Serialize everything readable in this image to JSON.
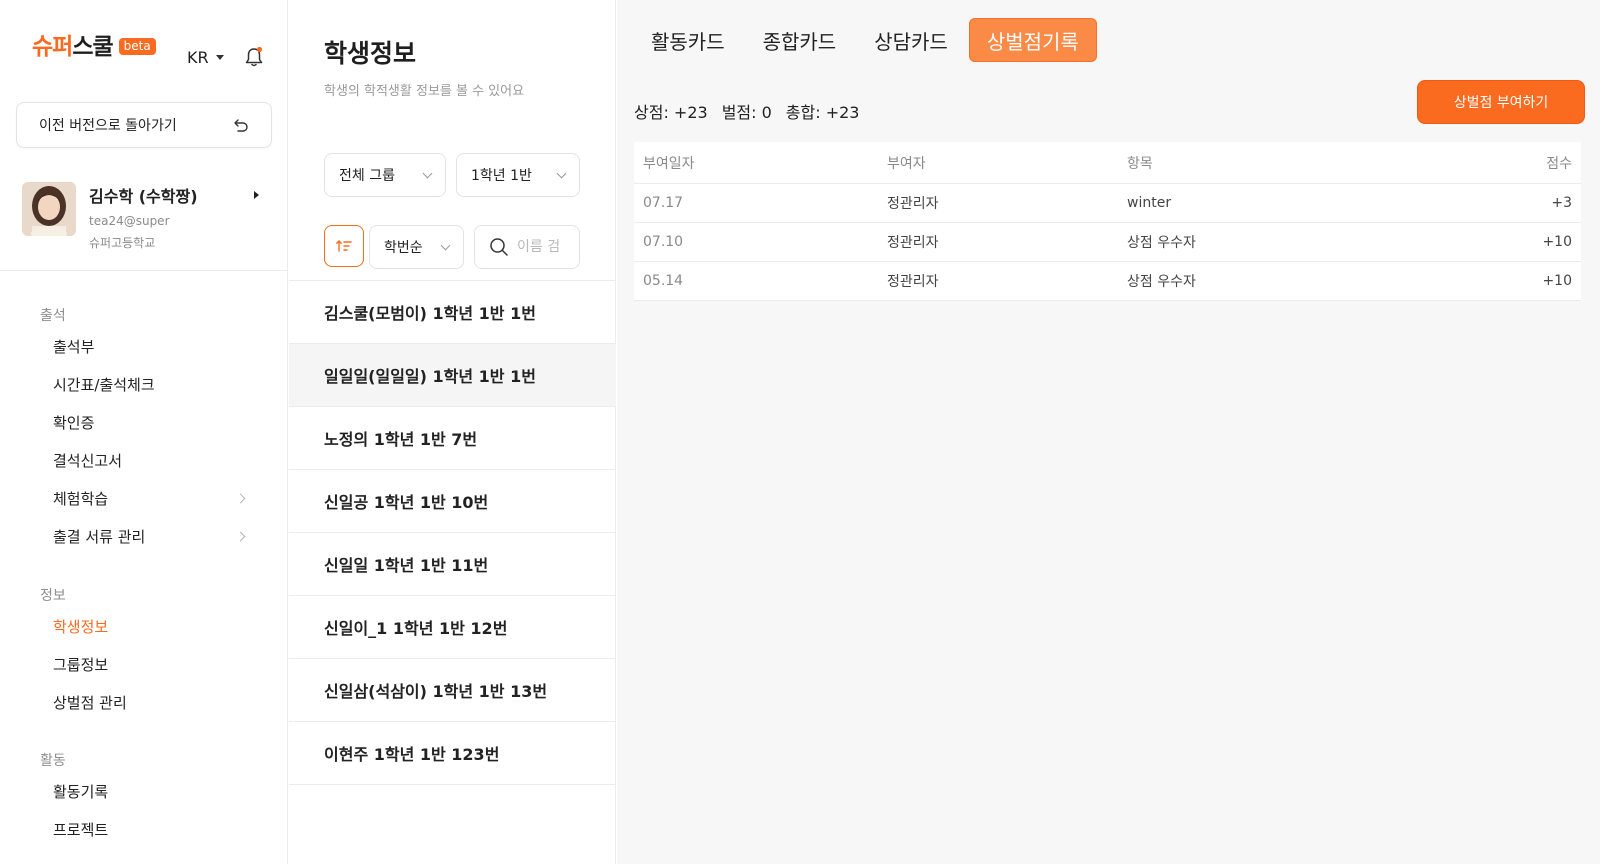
{
  "sidebar": {
    "logo_part1": "슈퍼",
    "logo_part2": "스쿨",
    "beta": "beta",
    "lang": "KR",
    "back_button": "이전 버전으로 돌아가기",
    "profile": {
      "name": "김수학 (수학짱)",
      "email": "tea24@super",
      "school": "슈퍼고등학교"
    },
    "sections": [
      {
        "title": "출석",
        "items": [
          "출석부",
          "시간표/출석체크",
          "확인증",
          "결석신고서",
          "체험학습",
          "출결 서류 관리"
        ]
      },
      {
        "title": "정보",
        "items": [
          "학생정보",
          "그룹정보",
          "상벌점 관리"
        ]
      },
      {
        "title": "활동",
        "items": [
          "활동기록",
          "프로젝트"
        ]
      }
    ]
  },
  "middle": {
    "title": "학생정보",
    "description": "학생의 학적생활 정보를 볼 수 있어요",
    "group_select": "전체 그룹",
    "class_select": "1학년 1반",
    "sort_select": "학번순",
    "search_placeholder": "이름 검",
    "students": [
      "김스쿨(모범이) 1학년 1반 1번",
      "일일일(일일일) 1학년 1반 1번",
      "노정의 1학년 1반 7번",
      "신일공 1학년 1반 10번",
      "신일일 1학년 1반 11번",
      "신일이_1 1학년 1반 12번",
      "신일삼(석삼이) 1학년 1반 13번",
      "이현주 1학년 1반 123번"
    ]
  },
  "right": {
    "tabs": [
      "활동카드",
      "종합카드",
      "상담카드",
      "상벌점기록"
    ],
    "award_button": "상벌점 부여하기",
    "summary": {
      "merit": "상점: +23",
      "demerit": "벌점: 0",
      "total": "총합: +23"
    },
    "table": {
      "headers": [
        "부여일자",
        "부여자",
        "항목",
        "점수"
      ],
      "rows": [
        [
          "07.17",
          "정관리자",
          "winter",
          "+3"
        ],
        [
          "07.10",
          "정관리자",
          "상점 우수자",
          "+10"
        ],
        [
          "05.14",
          "정관리자",
          "상점 우수자",
          "+10"
        ]
      ]
    }
  },
  "colors": {
    "accent": "#fa6a1f",
    "accent_tab": "#fb8a47",
    "panel_bg": "#f7f7f8"
  }
}
